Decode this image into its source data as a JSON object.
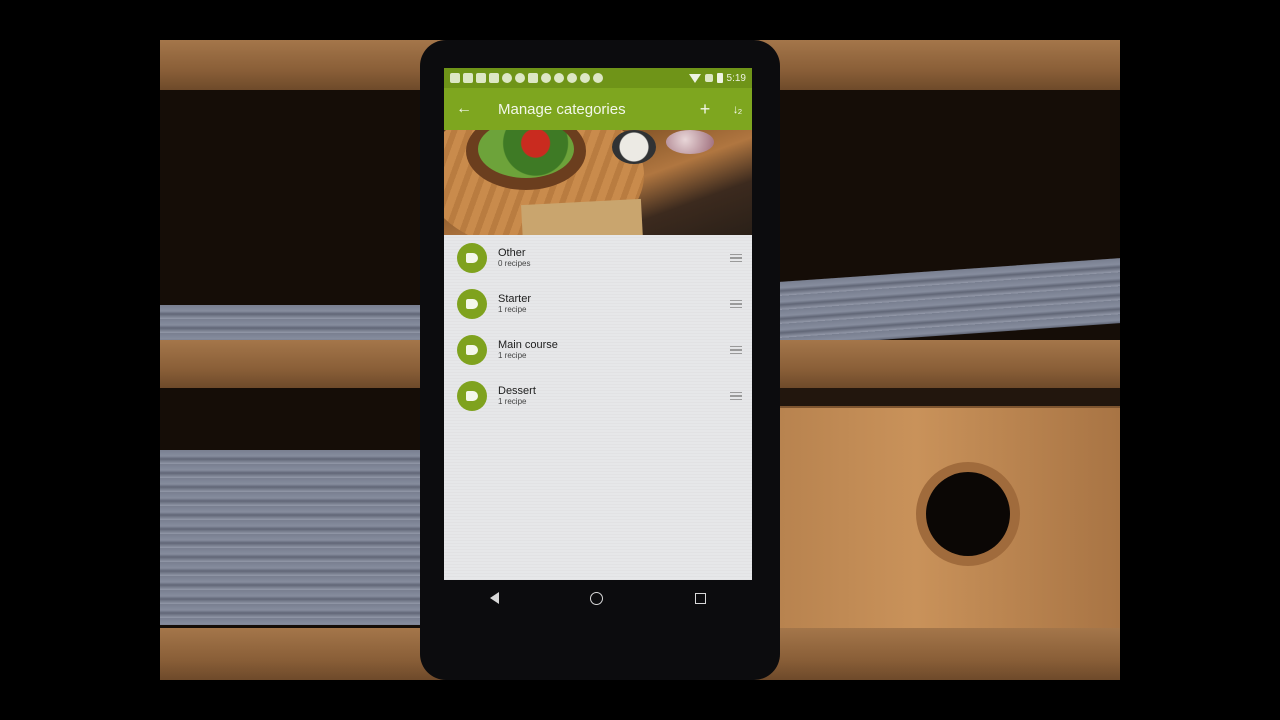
{
  "statusbar": {
    "time": "5:19",
    "notification_icons": [
      "sms-icon",
      "facebook-icon",
      "news-icon",
      "facebook-icon",
      "pinterest-icon",
      "mail-icon",
      "game-icon",
      "pinterest-icon",
      "pinterest-icon",
      "pinterest-icon",
      "pinterest-icon",
      "pinterest-icon"
    ]
  },
  "appbar": {
    "back_icon": "←",
    "title": "Manage categories",
    "add_icon": "+",
    "sort_icon": "↓₂"
  },
  "categories": [
    {
      "name": "Other",
      "count": "0 recipes"
    },
    {
      "name": "Starter",
      "count": "1 recipe"
    },
    {
      "name": "Main course",
      "count": "1 recipe"
    },
    {
      "name": "Dessert",
      "count": "1 recipe"
    }
  ],
  "colors": {
    "primary": "#7ea61f",
    "statusbar": "#6f9418",
    "avatar": "#7fa21e"
  }
}
